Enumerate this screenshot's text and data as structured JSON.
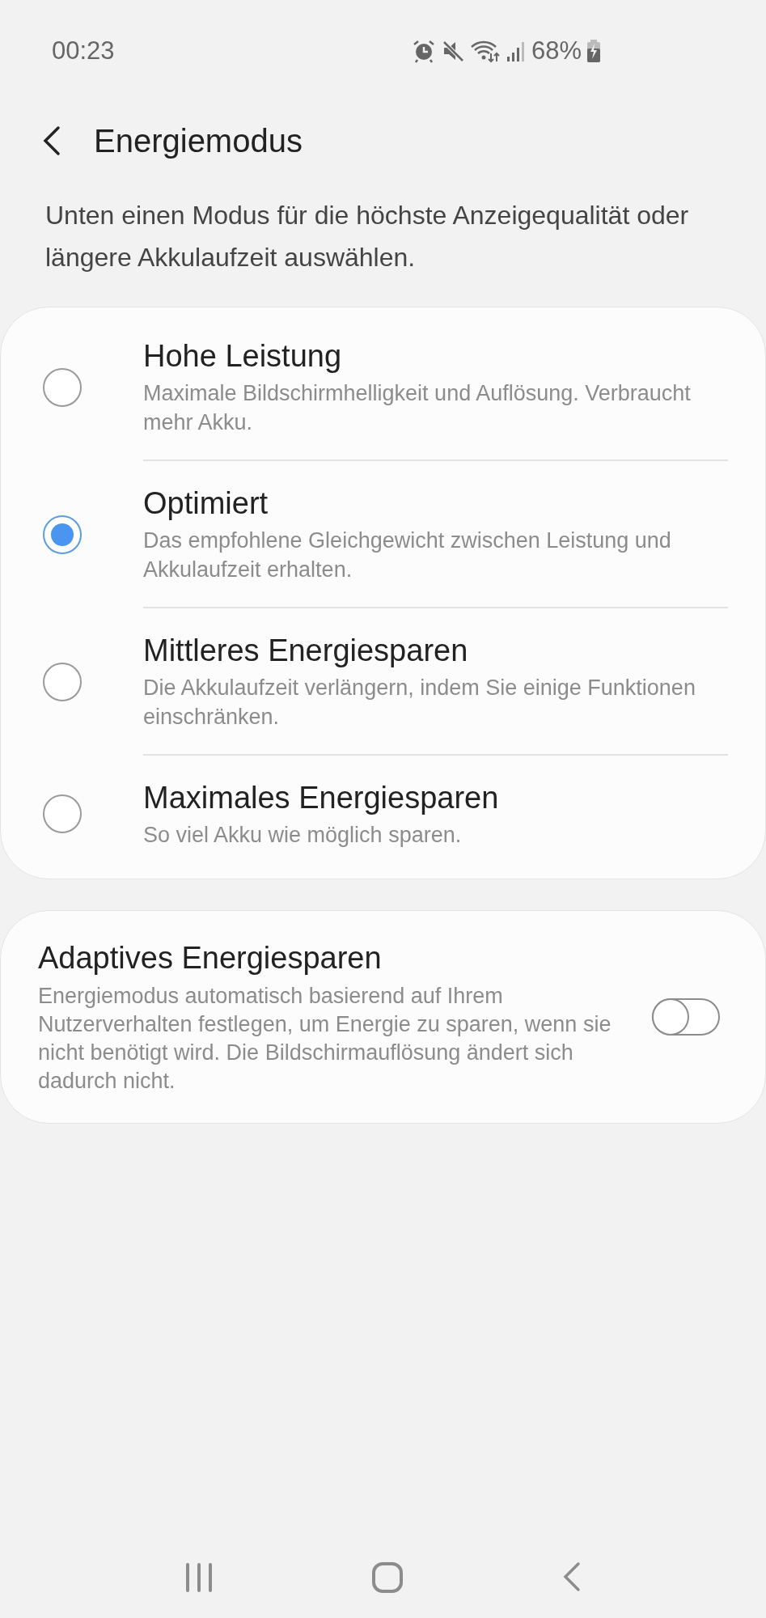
{
  "status_bar": {
    "time": "00:23",
    "battery": "68%"
  },
  "header": {
    "title": "Energiemodus"
  },
  "description": "Unten einen Modus für die höchste Anzeigequalität oder längere Akkulaufzeit auswählen.",
  "modes": [
    {
      "title": "Hohe Leistung",
      "subtitle": "Maximale Bildschirmhelligkeit und Auflösung. Verbraucht mehr Akku.",
      "selected": false
    },
    {
      "title": "Optimiert",
      "subtitle": "Das empfohlene Gleichgewicht zwischen Leistung und Akkulaufzeit erhalten.",
      "selected": true
    },
    {
      "title": "Mittleres Energiesparen",
      "subtitle": "Die Akkulaufzeit verlängern, indem Sie einige Funktionen einschränken.",
      "selected": false
    },
    {
      "title": "Maximales Energiesparen",
      "subtitle": "So viel Akku wie möglich sparen.",
      "selected": false
    }
  ],
  "adaptive": {
    "title": "Adaptives Energiesparen",
    "subtitle": "Energiemodus automatisch basierend auf Ihrem Nutzerverhalten festlegen, um Energie zu sparen, wenn sie nicht benötigt wird. Die Bildschirmauflösung ändert sich dadurch nicht.",
    "on": false
  }
}
